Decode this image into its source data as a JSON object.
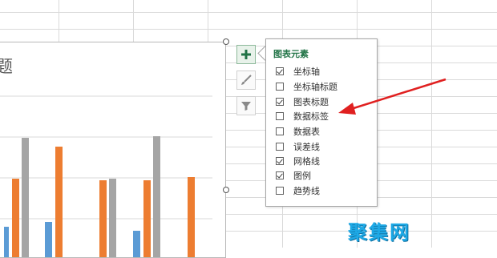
{
  "chart": {
    "title_partial": "题",
    "bar_colors": {
      "blue": "#5b9bd5",
      "orange": "#ed7d31",
      "gray": "#a5a5a5"
    }
  },
  "side_buttons": [
    {
      "icon": "plus-icon",
      "active": true
    },
    {
      "icon": "brush-icon",
      "active": false
    },
    {
      "icon": "filter-icon",
      "active": false
    }
  ],
  "panel": {
    "title": "图表元素",
    "options": [
      {
        "label": "坐标轴",
        "checked": true
      },
      {
        "label": "坐标轴标题",
        "checked": false
      },
      {
        "label": "图表标题",
        "checked": true
      },
      {
        "label": "数据标签",
        "checked": false
      },
      {
        "label": "数据表",
        "checked": false
      },
      {
        "label": "误差线",
        "checked": false
      },
      {
        "label": "网格线",
        "checked": true
      },
      {
        "label": "图例",
        "checked": true
      },
      {
        "label": "趋势线",
        "checked": false
      }
    ]
  },
  "watermark": "聚集网",
  "colors": {
    "accent_green": "#217346",
    "annotation_red": "#e02020"
  }
}
